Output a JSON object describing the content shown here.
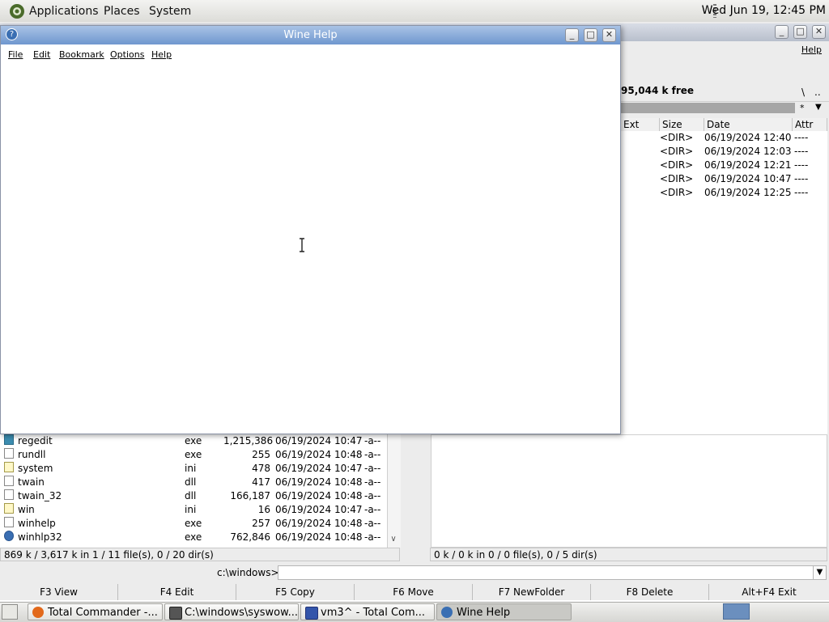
{
  "top_panel": {
    "menus": [
      "Applications",
      "Places",
      "System"
    ],
    "clock": "Wed Jun 19, 12:45 PM"
  },
  "tc": {
    "menu_help": "Help",
    "right_free": "95,044 k free",
    "drive_buttons": [
      "\\",
      ".."
    ],
    "filter": "*",
    "right_headers": [
      "Ext",
      "Size",
      "Date",
      "Attr"
    ],
    "right_rows": [
      {
        "size": "<DIR>",
        "date": "06/19/2024 12:40",
        "attr": "----"
      },
      {
        "size": "<DIR>",
        "date": "06/19/2024 12:03",
        "attr": "----"
      },
      {
        "size": "<DIR>",
        "date": "06/19/2024 12:21",
        "attr": "----"
      },
      {
        "size": "<DIR>",
        "date": "06/19/2024 10:47",
        "attr": "----"
      },
      {
        "size": "<DIR>",
        "date": "06/19/2024 12:25",
        "attr": "----"
      }
    ],
    "left_rows": [
      {
        "name": "regedit",
        "ext": "exe",
        "size": "1,215,386",
        "date": "06/19/2024 10:47",
        "attr": "-a--"
      },
      {
        "name": "rundll",
        "ext": "exe",
        "size": "255",
        "date": "06/19/2024 10:48",
        "attr": "-a--"
      },
      {
        "name": "system",
        "ext": "ini",
        "size": "478",
        "date": "06/19/2024 10:47",
        "attr": "-a--"
      },
      {
        "name": "twain",
        "ext": "dll",
        "size": "417",
        "date": "06/19/2024 10:48",
        "attr": "-a--"
      },
      {
        "name": "twain_32",
        "ext": "dll",
        "size": "166,187",
        "date": "06/19/2024 10:48",
        "attr": "-a--"
      },
      {
        "name": "win",
        "ext": "ini",
        "size": "16",
        "date": "06/19/2024 10:47",
        "attr": "-a--"
      },
      {
        "name": "winhelp",
        "ext": "exe",
        "size": "257",
        "date": "06/19/2024 10:48",
        "attr": "-a--"
      },
      {
        "name": "winhlp32",
        "ext": "exe",
        "size": "762,846",
        "date": "06/19/2024 10:48",
        "attr": "-a--"
      }
    ],
    "left_status": "869 k / 3,617 k in 1 / 11 file(s), 0 / 20 dir(s)",
    "right_status": "0 k / 0 k in 0 / 0 file(s), 0 / 5 dir(s)",
    "cmd_path": "c:\\windows>",
    "fkeys": [
      "F3 View",
      "F4 Edit",
      "F5 Copy",
      "F6 Move",
      "F7 NewFolder",
      "F8 Delete",
      "Alt+F4 Exit"
    ]
  },
  "winehelp": {
    "title": "Wine Help",
    "menus": [
      "File",
      "Edit",
      "Bookmark",
      "Options",
      "Help"
    ]
  },
  "taskbar": {
    "tasks": [
      "Total Commander -...",
      "C:\\windows\\syswow...",
      "vm3^ - Total Com...",
      "Wine Help"
    ]
  },
  "colors": {
    "help_title": "#6f97cf",
    "selection_bar": "#a6a6a6"
  }
}
